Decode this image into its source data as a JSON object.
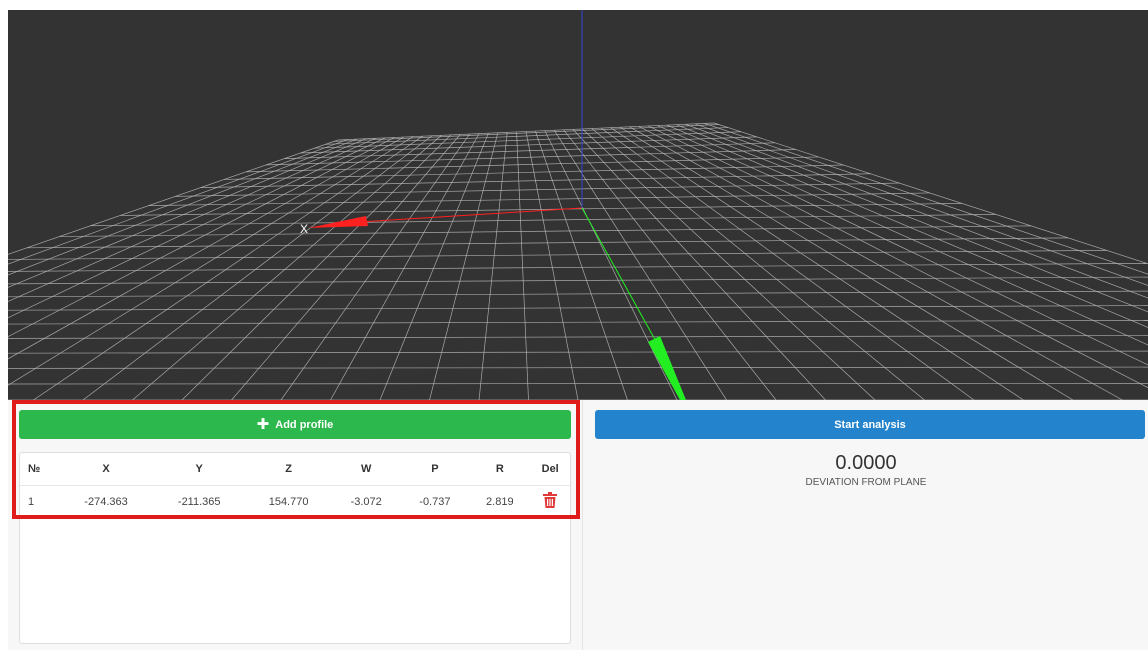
{
  "viewport": {
    "background": "#333333",
    "axis_x_label": "X",
    "colors": {
      "x_axis": "#ff2020",
      "y_axis": "#22ee22",
      "z_axis": "#3344cc",
      "grid": "#bdbdbd"
    }
  },
  "profiles": {
    "add_button_label": "Add profile",
    "add_button_icon": "plus-icon",
    "columns": [
      "№",
      "X",
      "Y",
      "Z",
      "W",
      "P",
      "R",
      "Del"
    ],
    "rows": [
      {
        "n": "1",
        "x": "-274.363",
        "y": "-211.365",
        "z": "154.770",
        "w": "-3.072",
        "p": "-0.737",
        "r": "2.819",
        "del_icon": "trash-icon"
      }
    ]
  },
  "analysis": {
    "start_button_label": "Start analysis",
    "deviation_value": "0.0000",
    "deviation_label": "DEVIATION FROM PLANE"
  },
  "colors": {
    "add_button": "#2cb84d",
    "start_button": "#2384cd",
    "highlight": "#e01b1b",
    "delete_icon": "#e03a3a"
  }
}
